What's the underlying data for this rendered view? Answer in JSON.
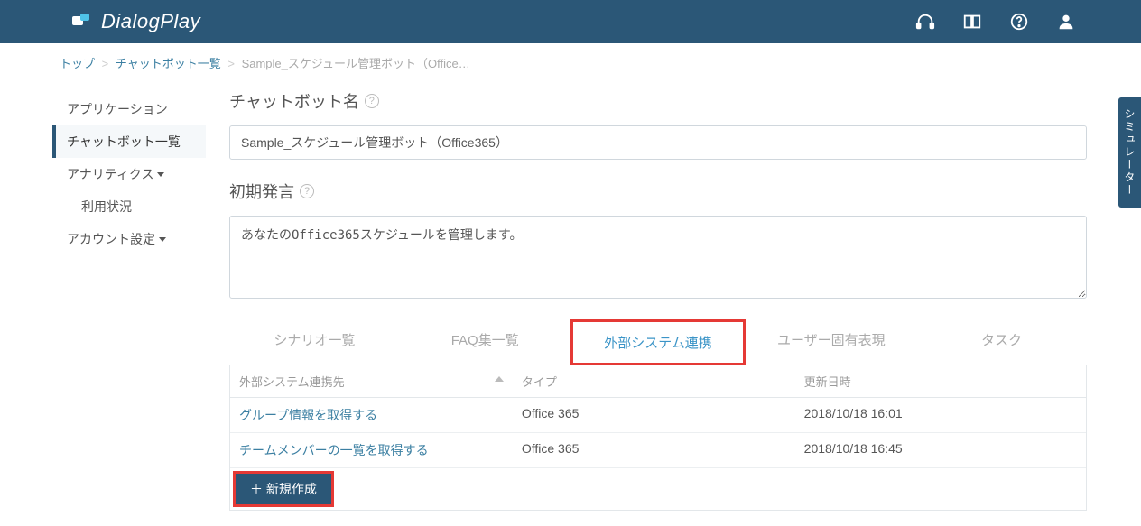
{
  "app": {
    "name": "DialogPlay"
  },
  "breadcrumb": {
    "top": "トップ",
    "list": "チャットボット一覧",
    "current": "Sample_スケジュール管理ボット（Office…"
  },
  "sidebar": {
    "items": [
      {
        "label": "アプリケーション"
      },
      {
        "label": "チャットボット一覧",
        "active": true
      },
      {
        "label": "アナリティクス",
        "hasCaret": true
      },
      {
        "label": "利用状況",
        "sub": true
      },
      {
        "label": "アカウント設定",
        "hasCaret": true
      }
    ]
  },
  "form": {
    "name_label": "チャットボット名",
    "name_value": "Sample_スケジュール管理ボット（Office365）",
    "initial_label": "初期発言",
    "initial_value": "あなたのOffice365スケジュールを管理します。"
  },
  "tabs": [
    {
      "label": "シナリオ一覧"
    },
    {
      "label": "FAQ集一覧"
    },
    {
      "label": "外部システム連携",
      "active": true,
      "highlighted": true
    },
    {
      "label": "ユーザー固有表現"
    },
    {
      "label": "タスク"
    }
  ],
  "table": {
    "headers": {
      "name": "外部システム連携先",
      "type": "タイプ",
      "updated": "更新日時"
    },
    "rows": [
      {
        "name": "グループ情報を取得する",
        "type": "Office 365",
        "updated": "2018/10/18 16:01"
      },
      {
        "name": "チームメンバーの一覧を取得する",
        "type": "Office 365",
        "updated": "2018/10/18 16:45"
      }
    ],
    "new_button": "＋ 新規作成"
  },
  "simulator_tab": "シミュレーター"
}
